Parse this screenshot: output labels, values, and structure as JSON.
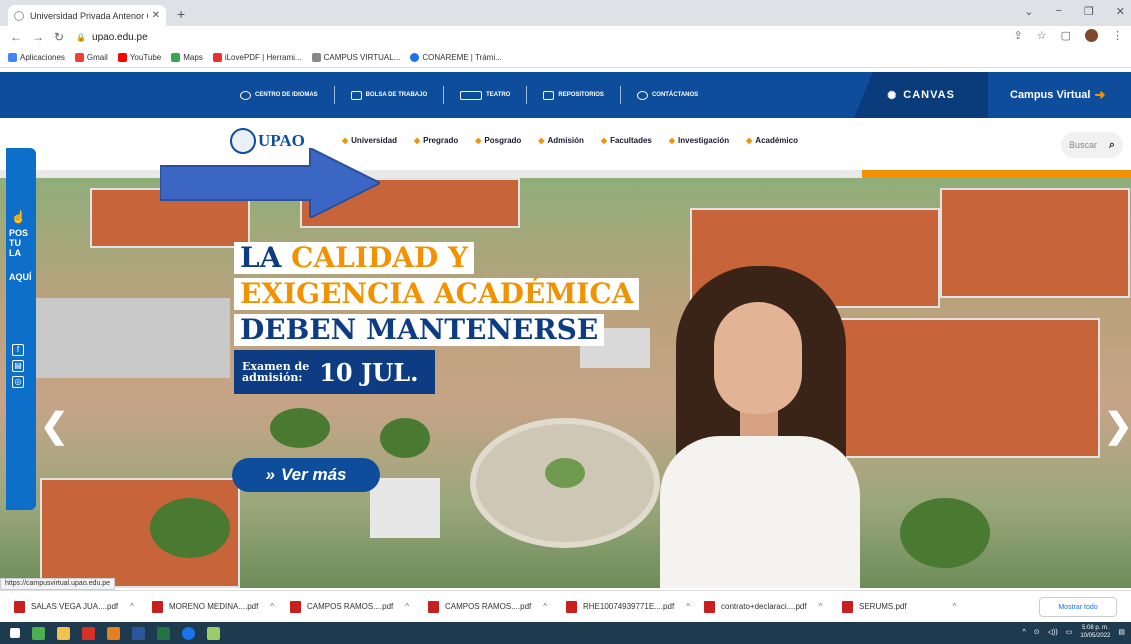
{
  "browser": {
    "tab_title": "Universidad Privada Antenor Or...",
    "url": "upao.edu.pe",
    "bookmarks": [
      {
        "label": "Aplicaciones",
        "color": "#4285f4"
      },
      {
        "label": "Gmail",
        "color": "#ea4335"
      },
      {
        "label": "YouTube",
        "color": "#ff0000"
      },
      {
        "label": "Maps",
        "color": "#34a853"
      },
      {
        "label": "iLovePDF | Herrami...",
        "color": "#e5322d"
      },
      {
        "label": "CAMPUS VIRTUAL...",
        "color": "#888888"
      },
      {
        "label": "CONAREME | Trámi...",
        "color": "#1a73e8"
      }
    ]
  },
  "site": {
    "top_links": [
      "CENTRO DE IDIOMAS",
      "BOLSA DE TRABAJO",
      "TEATRO",
      "REPOSITORIOS",
      "CONTÁCTANOS"
    ],
    "canvas_label": "CANVAS",
    "campus_label": "Campus Virtual",
    "logo_text": "UPAO",
    "nav": [
      "Universidad",
      "Pregrado",
      "Posgrado",
      "Admisión",
      "Facultades",
      "Investigación",
      "Académico"
    ],
    "search_placeholder": "Buscar"
  },
  "hero": {
    "line1_a": "LA ",
    "line1_b": "CALIDAD Y",
    "line2": "EXIGENCIA ACADÉMICA",
    "line3": "DEBEN MANTENERSE",
    "exam_small_1": "Examen de",
    "exam_small_2": "admisión:",
    "exam_date": "10 JUL.",
    "cta": "Ver más",
    "side_text": [
      "POS",
      "TU",
      "LA",
      "AQUÍ"
    ],
    "colors": {
      "blue": "#0d3c82",
      "orange": "#f39200"
    }
  },
  "status_url": "https://campusvirtual.upao.edu.pe",
  "downloads": [
    "SALAS VEGA JUA....pdf",
    "MORENO MEDINA....pdf",
    "CAMPOS RAMOS....pdf",
    "CAMPOS RAMOS....pdf",
    "RHE10074939771E....pdf",
    "contrato+declaraci....pdf",
    "SERUMS.pdf"
  ],
  "show_all": "Mostrar todo",
  "clock": {
    "time": "5:08 p. m.",
    "date": "10/05/2022"
  }
}
